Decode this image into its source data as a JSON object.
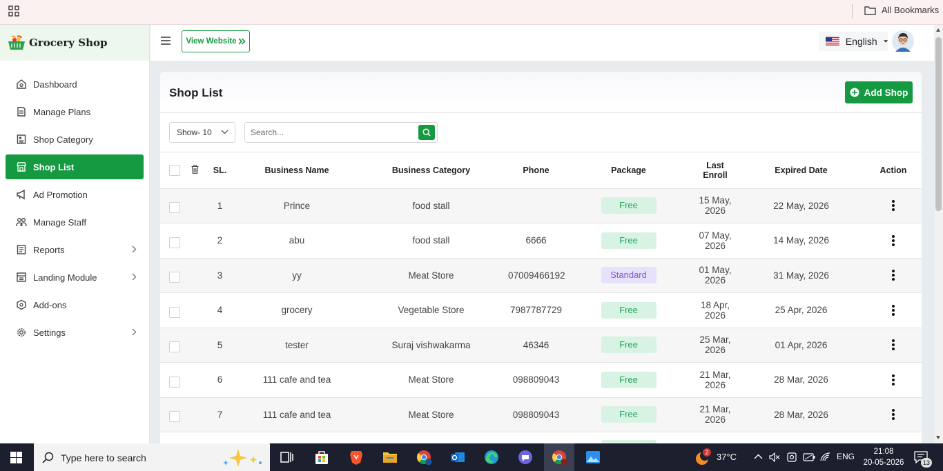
{
  "bookmarks_bar": {
    "all_bookmarks": "All Bookmarks"
  },
  "brand": {
    "name": "Grocery Shop"
  },
  "sidebar": {
    "items": [
      {
        "label": "Dashboard",
        "icon": "dashboard-icon",
        "has_submenu": false,
        "active": false
      },
      {
        "label": "Manage Plans",
        "icon": "plans-icon",
        "has_submenu": false,
        "active": false
      },
      {
        "label": "Shop Category",
        "icon": "category-icon",
        "has_submenu": false,
        "active": false
      },
      {
        "label": "Shop List",
        "icon": "shop-icon",
        "has_submenu": false,
        "active": true
      },
      {
        "label": "Ad Promotion",
        "icon": "megaphone-icon",
        "has_submenu": false,
        "active": false
      },
      {
        "label": "Manage Staff",
        "icon": "staff-icon",
        "has_submenu": false,
        "active": false
      },
      {
        "label": "Reports",
        "icon": "reports-icon",
        "has_submenu": true,
        "active": false
      },
      {
        "label": "Landing Module",
        "icon": "landing-icon",
        "has_submenu": true,
        "active": false
      },
      {
        "label": "Add-ons",
        "icon": "addons-icon",
        "has_submenu": false,
        "active": false
      },
      {
        "label": "Settings",
        "icon": "gear-icon",
        "has_submenu": true,
        "active": false
      }
    ]
  },
  "header": {
    "view_website": "View Website",
    "language": "English"
  },
  "page": {
    "title": "Shop List",
    "add_button": "Add Shop",
    "show_select": "Show- 10",
    "search_placeholder": "Search..."
  },
  "table": {
    "columns": [
      "SL.",
      "Business Name",
      "Business Category",
      "Phone",
      "Package",
      "Last Enroll",
      "Expired Date",
      "Action"
    ],
    "rows": [
      {
        "sl": "1",
        "name": "Prince",
        "category": "food stall",
        "phone": "",
        "package": "Free",
        "last_enroll": "15 May, 2026",
        "expired": "22 May, 2026"
      },
      {
        "sl": "2",
        "name": "abu",
        "category": "food stall",
        "phone": "6666",
        "package": "Free",
        "last_enroll": "07 May, 2026",
        "expired": "14 May, 2026"
      },
      {
        "sl": "3",
        "name": "yy",
        "category": "Meat Store",
        "phone": "07009466192",
        "package": "Standard",
        "last_enroll": "01 May, 2026",
        "expired": "31 May, 2026"
      },
      {
        "sl": "4",
        "name": "grocery",
        "category": "Vegetable Store",
        "phone": "7987787729",
        "package": "Free",
        "last_enroll": "18 Apr, 2026",
        "expired": "25 Apr, 2026"
      },
      {
        "sl": "5",
        "name": "tester",
        "category": "Suraj vishwakarma",
        "phone": "46346",
        "package": "Free",
        "last_enroll": "25 Mar, 2026",
        "expired": "01 Apr, 2026"
      },
      {
        "sl": "6",
        "name": "111 cafe and tea",
        "category": "Meat Store",
        "phone": "098809043",
        "package": "Free",
        "last_enroll": "21 Mar, 2026",
        "expired": "28 Mar, 2026"
      },
      {
        "sl": "7",
        "name": "111 cafe and tea",
        "category": "Meat Store",
        "phone": "098809043",
        "package": "Free",
        "last_enroll": "21 Mar, 2026",
        "expired": "28 Mar, 2026"
      }
    ]
  },
  "taskbar": {
    "search_placeholder": "Type here to search",
    "weather": "37°C",
    "weather_badge": "2",
    "language": "ENG",
    "time": "21:08",
    "date": "20-05-2026",
    "notifications": "13"
  },
  "colors": {
    "accent": "#159a42",
    "free_badge_bg": "#d8f3e3",
    "standard_badge_bg": "#e8e1fb",
    "taskbar": "#1b1f2e"
  }
}
